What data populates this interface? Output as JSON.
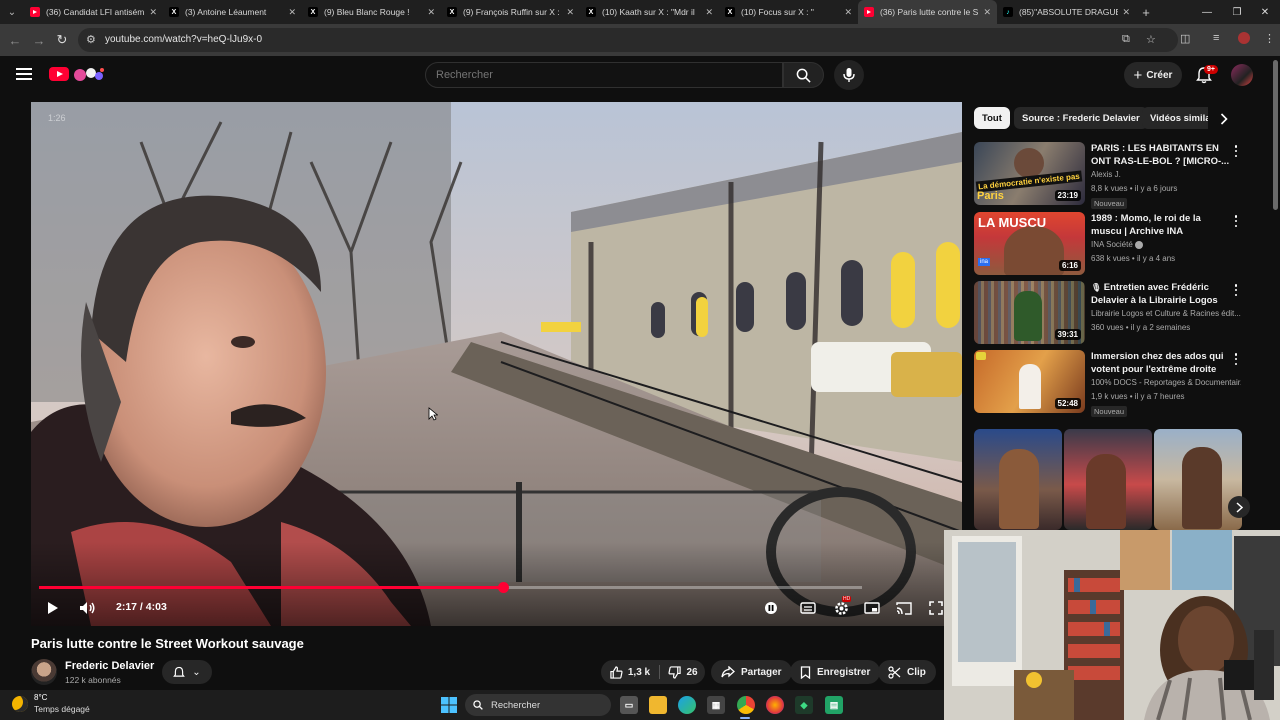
{
  "browser": {
    "tabs": [
      {
        "title": "(36) Candidat LFI antisém",
        "icon": "youtube",
        "active": false
      },
      {
        "title": "(3) Antoine Léaument",
        "icon": "x",
        "active": false
      },
      {
        "title": "(9) Bleu Blanc Rouge !",
        "icon": "x",
        "active": false
      },
      {
        "title": "(9) François Ruffin sur X :",
        "icon": "x",
        "active": false
      },
      {
        "title": "(10) Kaath sur X : \"Mdr il",
        "icon": "x",
        "active": false
      },
      {
        "title": "(10) Focus sur X : \"",
        "icon": "x",
        "active": false
      },
      {
        "title": "(36) Paris lutte contre le S",
        "icon": "youtube",
        "active": true
      },
      {
        "title": "(85)\"ABSOLUTE DRAGUE",
        "icon": "tiktok",
        "active": false
      }
    ],
    "url": "youtube.com/watch?v=heQ-lJu9x-0"
  },
  "header": {
    "search_placeholder": "Rechercher",
    "create_label": "Créer",
    "notif_count": "9+"
  },
  "player": {
    "watermark": "1:26",
    "current_time": "2:17",
    "duration": "4:03",
    "time_display": "2:17 / 4:03",
    "progress_fraction": 0.5638
  },
  "video": {
    "title": "Paris lutte contre le Street Workout sauvage",
    "channel": "Frederic Delavier",
    "subscribers": "122 k abonnés",
    "likes": "1,3 k",
    "dislikes": "26",
    "share_label": "Partager",
    "save_label": "Enregistrer",
    "clip_label": "Clip"
  },
  "sidebar": {
    "chips": [
      "Tout",
      "Source : Frederic Delavier",
      "Vidéos simila"
    ],
    "recommendations": [
      {
        "title": "PARIS : LES HABITANTS EN ONT RAS-LE-BOL ? [MICRO-...",
        "channel": "Alexis J.",
        "meta": "8,8 k vues • il y a 6 jours",
        "duration": "23:19",
        "badge": "Nouveau",
        "thumb_text_1": "La démocratie n'existe pas",
        "thumb_text_2": "Paris"
      },
      {
        "title": "1989 : Momo, le roi de la muscu | Archive INA",
        "channel": "INA Société",
        "meta": "638 k vues • il y a 4 ans",
        "duration": "6:16",
        "badge": "",
        "thumb_text_1": "LA MUSCU",
        "thumb_text_2": "ina"
      },
      {
        "title": "Entretien avec Frédéric Delavier à la Librairie Logos",
        "channel": "Librairie Logos et Culture & Racines édit...",
        "meta": "360 vues • il y a 2 semaines",
        "duration": "39:31",
        "badge": "",
        "thumb_text_1": "",
        "thumb_text_2": ""
      },
      {
        "title": "Immersion chez des ados qui votent pour l'extrême droite",
        "channel": "100% DOCS - Reportages & Documentair...",
        "meta": "1,9 k vues • il y a 7 heures",
        "duration": "52:48",
        "badge": "Nouveau",
        "thumb_text_1": "",
        "thumb_text_2": ""
      }
    ]
  },
  "taskbar": {
    "temperature": "8°C",
    "weather": "Temps dégagé",
    "search_label": "Rechercher"
  }
}
